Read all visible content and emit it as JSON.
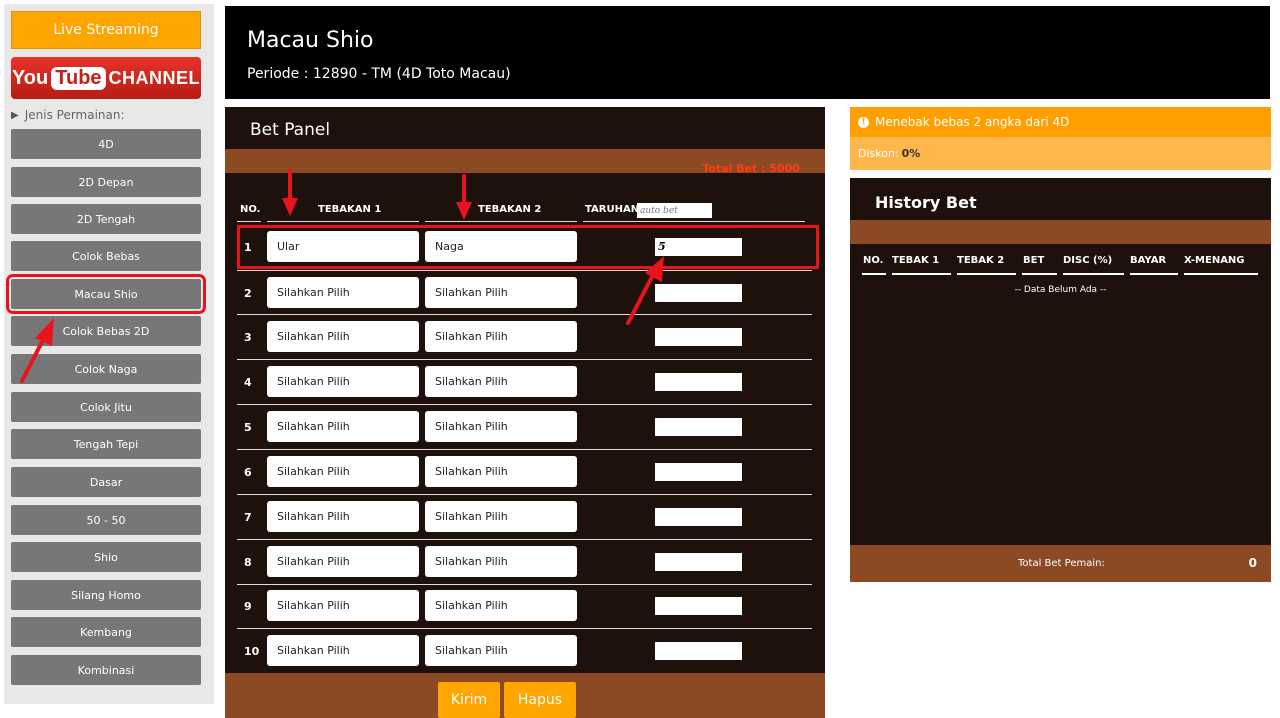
{
  "sidebar": {
    "live_label": "Live Streaming",
    "youtube": {
      "you": "You",
      "tube": "Tube",
      "channel": "CHANNEL"
    },
    "jenis_label": "Jenis Permainan:",
    "items": [
      "4D",
      "2D Depan",
      "2D Tengah",
      "Colok Bebas",
      "Macau Shio",
      "Colok Bebas 2D",
      "Colok Naga",
      "Colok Jitu",
      "Tengah Tepi",
      "Dasar",
      "50 - 50",
      "Shio",
      "Silang Homo",
      "Kembang",
      "Kombinasi"
    ],
    "active_item": "Macau Shio"
  },
  "header": {
    "title": "Macau Shio",
    "periode": "Periode : 12890 - TM (4D Toto Macau)"
  },
  "bet_panel": {
    "title": "Bet Panel",
    "total_bet": "Total Bet : 5000",
    "headers": {
      "no": "NO.",
      "tebakan1": "TEBAKAN 1",
      "tebakan2": "TEBAKAN 2",
      "taruhan": "TARUHAN"
    },
    "auto_bet_placeholder": "auto bet",
    "rows": [
      {
        "no": "1",
        "t1": "Ular",
        "t2": "Naga",
        "taruhan": "5"
      },
      {
        "no": "2",
        "t1": "Silahkan Pilih",
        "t2": "Silahkan Pilih",
        "taruhan": ""
      },
      {
        "no": "3",
        "t1": "Silahkan Pilih",
        "t2": "Silahkan Pilih",
        "taruhan": ""
      },
      {
        "no": "4",
        "t1": "Silahkan Pilih",
        "t2": "Silahkan Pilih",
        "taruhan": ""
      },
      {
        "no": "5",
        "t1": "Silahkan Pilih",
        "t2": "Silahkan Pilih",
        "taruhan": ""
      },
      {
        "no": "6",
        "t1": "Silahkan Pilih",
        "t2": "Silahkan Pilih",
        "taruhan": ""
      },
      {
        "no": "7",
        "t1": "Silahkan Pilih",
        "t2": "Silahkan Pilih",
        "taruhan": ""
      },
      {
        "no": "8",
        "t1": "Silahkan Pilih",
        "t2": "Silahkan Pilih",
        "taruhan": ""
      },
      {
        "no": "9",
        "t1": "Silahkan Pilih",
        "t2": "Silahkan Pilih",
        "taruhan": ""
      },
      {
        "no": "10",
        "t1": "Silahkan Pilih",
        "t2": "Silahkan Pilih",
        "taruhan": ""
      }
    ],
    "kirim_label": "Kirim",
    "hapus_label": "Hapus"
  },
  "info": {
    "message": "Menebak bebas 2 angka dari 4D",
    "diskon_label": "Diskon:",
    "diskon_value": "0%"
  },
  "history": {
    "title": "History Bet",
    "headers": [
      "NO.",
      "TEBAK 1",
      "TEBAK 2",
      "BET",
      "DISC (%)",
      "BAYAR",
      "X-MENANG"
    ],
    "empty_text": "-- Data Belum Ada --",
    "total_label": "Total Bet Pemain:",
    "total_value": "0"
  },
  "colors": {
    "accent": "#ffa500",
    "panel": "#1e100a",
    "brown": "#8b4a24",
    "annotation": "#e8141c"
  }
}
